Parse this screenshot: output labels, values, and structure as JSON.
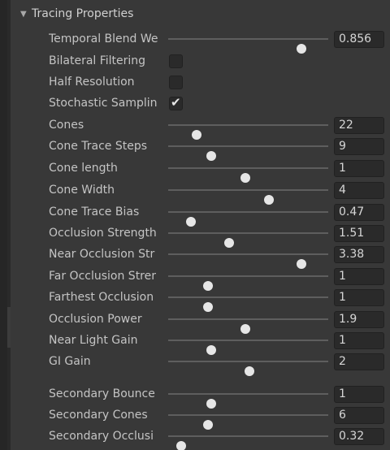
{
  "section": {
    "title": "Tracing Properties"
  },
  "sliders": [
    {
      "key": "temporal",
      "label": "Temporal Blend We",
      "value": "0.856",
      "level": 0.83
    },
    {
      "key": "cones",
      "label": "Cones",
      "value": "22",
      "level": 0.18
    },
    {
      "key": "cone-trace-steps",
      "label": "Cone Trace Steps",
      "value": "9",
      "level": 0.27
    },
    {
      "key": "cone-length",
      "label": "Cone length",
      "value": "1",
      "level": 0.48
    },
    {
      "key": "cone-width",
      "label": "Cone Width",
      "value": "4",
      "level": 0.63
    },
    {
      "key": "cone-trace-bias",
      "label": "Cone Trace Bias",
      "value": "0.47",
      "level": 0.14
    },
    {
      "key": "occlusion-strength",
      "label": "Occlusion Strength",
      "value": "1.51",
      "level": 0.38
    },
    {
      "key": "near-occlusion-str",
      "label": "Near Occlusion Str",
      "value": "3.38",
      "level": 0.83
    },
    {
      "key": "far-occlusion-str",
      "label": "Far Occlusion Strer",
      "value": "1",
      "level": 0.25
    },
    {
      "key": "farthest-occlusion",
      "label": "Farthest Occlusion",
      "value": "1",
      "level": 0.25
    },
    {
      "key": "occlusion-power",
      "label": "Occlusion Power",
      "value": "1.9",
      "level": 0.48
    },
    {
      "key": "near-light-gain",
      "label": "Near Light Gain",
      "value": "1",
      "level": 0.27
    },
    {
      "key": "gi-gain",
      "label": "GI Gain",
      "value": "2",
      "level": 0.51
    },
    {
      "key": "secondary-bounce",
      "label": "Secondary Bounce",
      "value": "1",
      "level": 0.27
    },
    {
      "key": "secondary-cones",
      "label": "Secondary Cones",
      "value": "6",
      "level": 0.25
    },
    {
      "key": "secondary-occlusion",
      "label": "Secondary Occlusi",
      "value": "0.32",
      "level": 0.08
    }
  ],
  "toggles": [
    {
      "key": "bilateral-filtering",
      "label": "Bilateral Filtering",
      "checked": false
    },
    {
      "key": "half-resolution",
      "label": "Half Resolution",
      "checked": false
    },
    {
      "key": "stochastic-sampling",
      "label": "Stochastic Samplin",
      "checked": true
    }
  ]
}
